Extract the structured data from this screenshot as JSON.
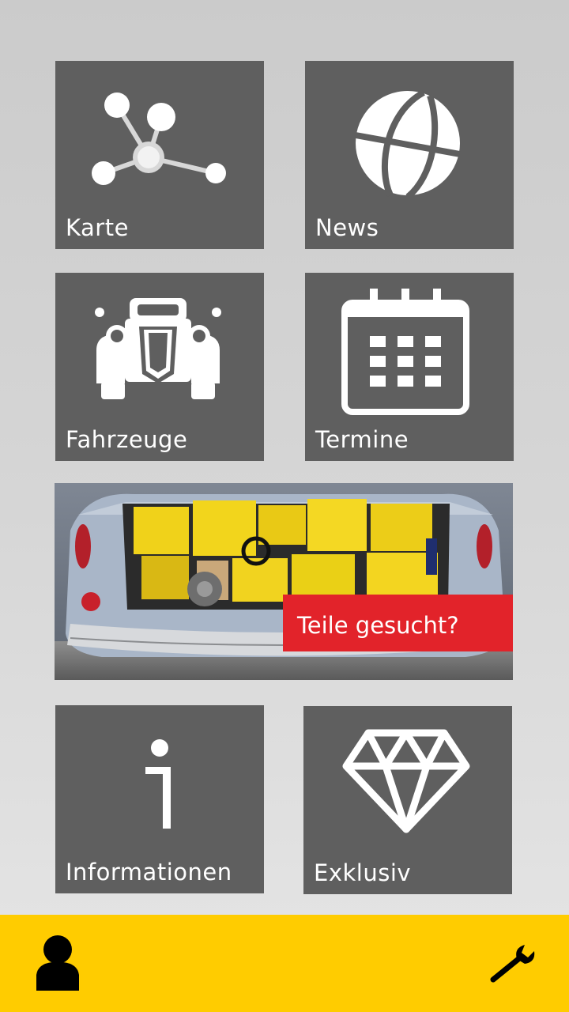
{
  "tiles": {
    "karte": {
      "label": "Karte",
      "icon": "network-icon"
    },
    "news": {
      "label": "News",
      "icon": "globe-icon"
    },
    "fahrzeuge": {
      "label": "Fahrzeuge",
      "icon": "vintage-car-icon"
    },
    "termine": {
      "label": "Termine",
      "icon": "calendar-icon"
    },
    "informationen": {
      "label": "Informationen",
      "icon": "info-icon"
    },
    "exklusiv": {
      "label": "Exklusiv",
      "icon": "diamond-icon"
    }
  },
  "banner": {
    "cta_label": "Teile gesucht?",
    "image": "car-trunk-with-parts-boxes"
  },
  "bottom_bar": {
    "left_icon": "user-icon",
    "right_icon": "wrench-icon"
  },
  "colors": {
    "tile": "#5f5f5f",
    "accent_yellow": "#ffcc00",
    "cta_red": "#e2232a",
    "background": "#d6d6d6"
  }
}
